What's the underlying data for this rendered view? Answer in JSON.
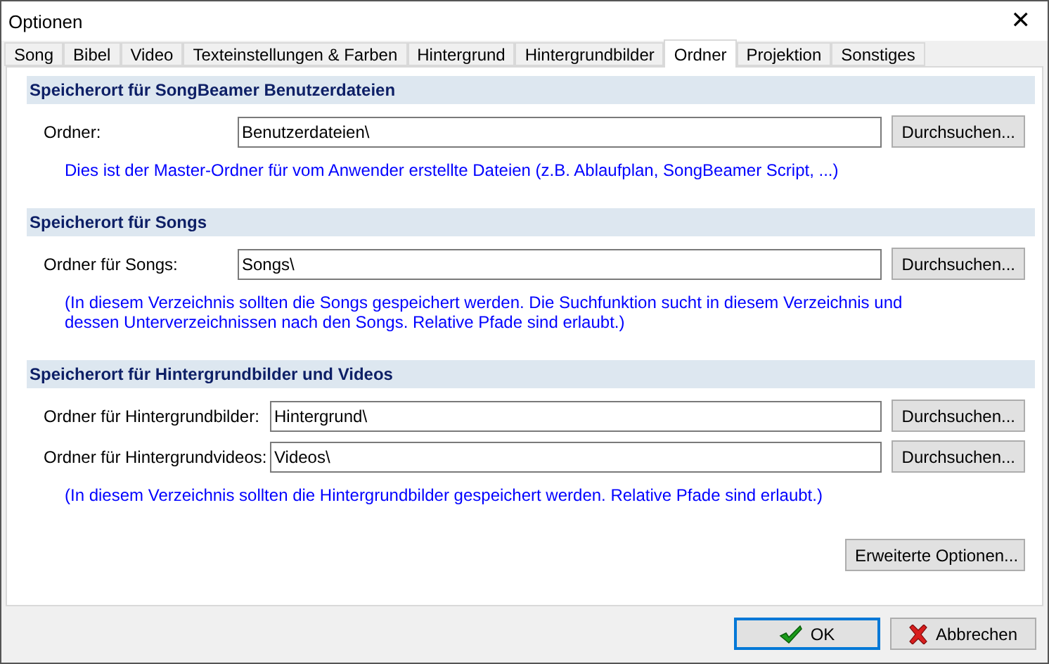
{
  "window": {
    "title": "Optionen",
    "close": "✕"
  },
  "tabs": [
    {
      "label": "Song",
      "selected": false
    },
    {
      "label": "Bibel",
      "selected": false
    },
    {
      "label": "Video",
      "selected": false
    },
    {
      "label": "Texteinstellungen & Farben",
      "selected": false
    },
    {
      "label": "Hintergrund",
      "selected": false
    },
    {
      "label": "Hintergrundbilder",
      "selected": false
    },
    {
      "label": "Ordner",
      "selected": true
    },
    {
      "label": "Projektion",
      "selected": false
    },
    {
      "label": "Sonstiges",
      "selected": false
    }
  ],
  "sections": [
    {
      "title": "Speicherort für SongBeamer Benutzerdateien",
      "rows": [
        {
          "label": "Ordner:",
          "value": "Benutzerdateien\\",
          "button": "Durchsuchen..."
        }
      ],
      "note": "Dies ist der Master-Ordner für vom Anwender erstellte Dateien (z.B. Ablaufplan, SongBeamer Script, ...)"
    },
    {
      "title": "Speicherort für Songs",
      "rows": [
        {
          "label": "Ordner für Songs:",
          "value": "Songs\\",
          "button": "Durchsuchen..."
        }
      ],
      "note": "(In diesem Verzeichnis sollten die Songs gespeichert werden. Die Suchfunktion sucht in diesem Verzeichnis und dessen Unterverzeichnissen nach den Songs. Relative Pfade sind erlaubt.)"
    },
    {
      "title": "Speicherort für Hintergrundbilder und Videos",
      "rows": [
        {
          "label": "Ordner für Hintergrundbilder:",
          "value": "Hintergrund\\",
          "button": "Durchsuchen..."
        },
        {
          "label": "Ordner für Hintergrundvideos:",
          "value": "Videos\\",
          "button": "Durchsuchen..."
        }
      ],
      "note": "(In diesem Verzeichnis sollten die Hintergrundbilder gespeichert werden. Relative Pfade sind erlaubt.)"
    }
  ],
  "extra_button": "Erweiterte Optionen...",
  "footer_buttons": [
    {
      "kind": "ok",
      "label": "OK",
      "default": true
    },
    {
      "kind": "cancel",
      "label": "Abbrechen",
      "default": false
    }
  ]
}
